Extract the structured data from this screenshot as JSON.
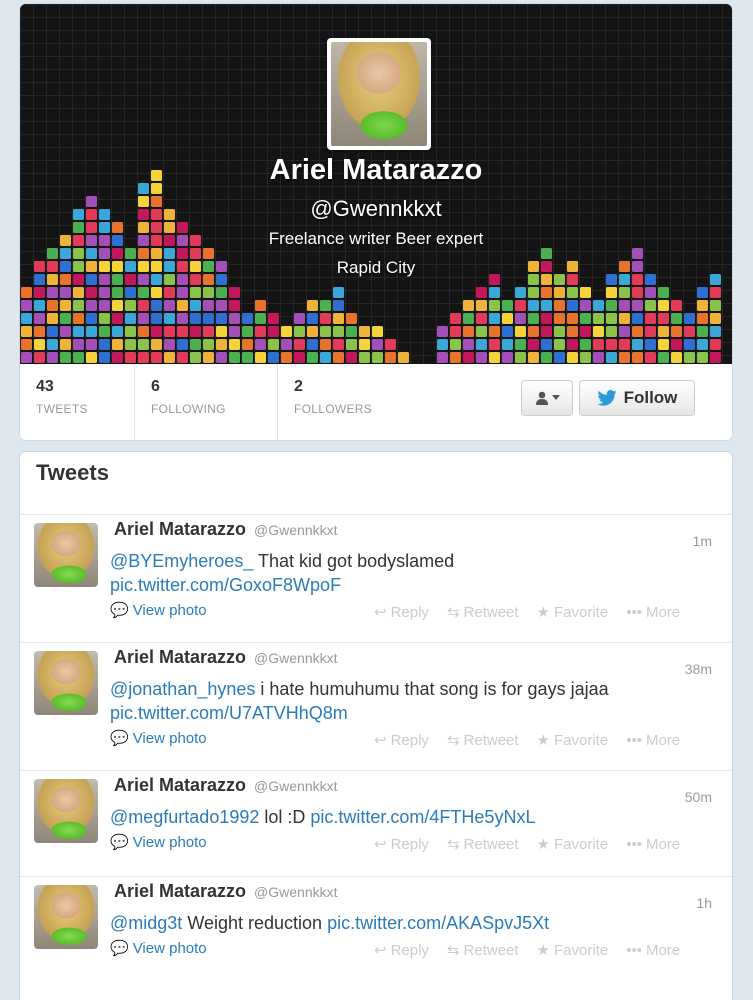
{
  "profile": {
    "name": "Ariel Matarazzo",
    "handle": "@Gwennkkxt",
    "bio": "Freelance writer Beer expert",
    "location": "Rapid City"
  },
  "stats": [
    {
      "value": "43",
      "label": "TWEETS"
    },
    {
      "value": "6",
      "label": "FOLLOWING"
    },
    {
      "value": "2",
      "label": "FOLLOWERS"
    }
  ],
  "follow_label": "Follow",
  "tweets_heading": "Tweets",
  "actions": {
    "reply": "Reply",
    "retweet": "Retweet",
    "favorite": "Favorite",
    "more": "More"
  },
  "view_photo": "View photo",
  "tweets": [
    {
      "name": "Ariel Matarazzo",
      "handle": "@Gwennkkxt",
      "time": "1m",
      "mention": "@BYEmyheroes_",
      "text": " That kid got bodyslamed",
      "link": "pic.twitter.com/GoxoF8WpoF"
    },
    {
      "name": "Ariel Matarazzo",
      "handle": "@Gwennkkxt",
      "time": "38m",
      "mention": "@jonathan_hynes",
      "text": " i hate humuhumu that song is for gays jajaa",
      "link": "pic.twitter.com/U7ATVHhQ8m"
    },
    {
      "name": "Ariel Matarazzo",
      "handle": "@Gwennkkxt",
      "time": "50m",
      "mention": "@megfurtado1992",
      "text": " lol :D ",
      "link": "pic.twitter.com/4FTHe5yNxL"
    },
    {
      "name": "Ariel Matarazzo",
      "handle": "@Gwennkkxt",
      "time": "1h",
      "mention": "@midg3t",
      "text": " Weight reduction ",
      "link": "pic.twitter.com/AKASpvJ5Xt"
    }
  ],
  "colors": {
    "link": "#2b7bb9",
    "twitter_bird": "#2b9cd8",
    "banner": "#141414"
  }
}
